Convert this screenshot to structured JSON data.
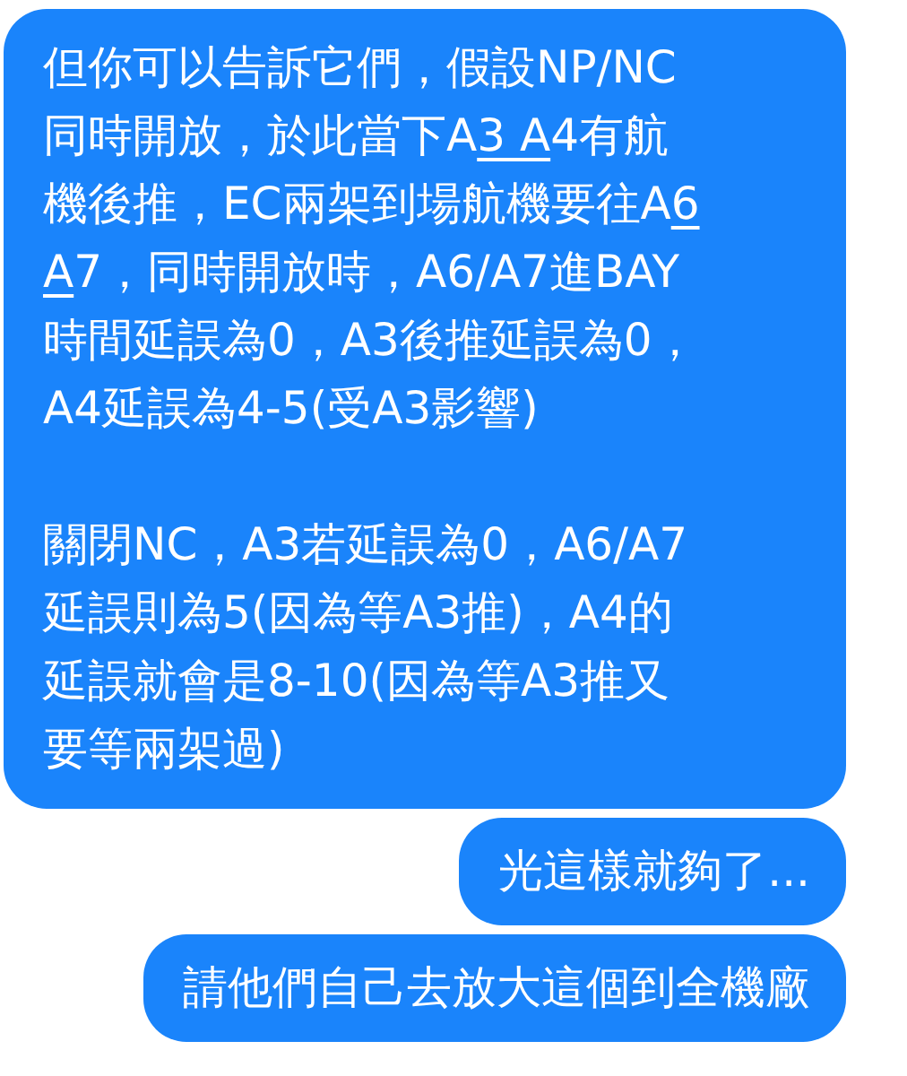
{
  "messages": [
    {
      "paragraphs": [
        [
          [
            {
              "kind": "text",
              "text": "但你可以告訴它們，假設NP/NC"
            }
          ],
          [
            {
              "kind": "text",
              "text": "同時開放，於此當下A"
            },
            {
              "kind": "link",
              "text": "3 A"
            },
            {
              "kind": "text",
              "text": "4有航"
            }
          ],
          [
            {
              "kind": "text",
              "text": "機後推，EC兩架到場航機要往A"
            },
            {
              "kind": "link",
              "text": "6"
            }
          ],
          [
            {
              "kind": "link",
              "text": "A"
            },
            {
              "kind": "text",
              "text": "7，同時開放時，A6/A7進BAY"
            }
          ],
          [
            {
              "kind": "text",
              "text": "時間延誤為0，A3後推延誤為0，"
            }
          ],
          [
            {
              "kind": "text",
              "text": "A4延誤為4-5(受A3影響)"
            }
          ]
        ],
        [
          [
            {
              "kind": "text",
              "text": "關閉NC，A3若延誤為0，A6/A7"
            }
          ],
          [
            {
              "kind": "text",
              "text": "延誤則為5(因為等A3推)，A4的"
            }
          ],
          [
            {
              "kind": "text",
              "text": "延誤就會是8-10(因為等A3推又"
            }
          ],
          [
            {
              "kind": "text",
              "text": "要等兩架過)"
            }
          ]
        ]
      ]
    },
    {
      "paragraphs": [
        [
          [
            {
              "kind": "text",
              "text": "光這樣就夠了..."
            }
          ]
        ]
      ]
    },
    {
      "paragraphs": [
        [
          [
            {
              "kind": "text",
              "text": "請他們自己去放大這個到全機廠"
            }
          ]
        ]
      ]
    }
  ]
}
